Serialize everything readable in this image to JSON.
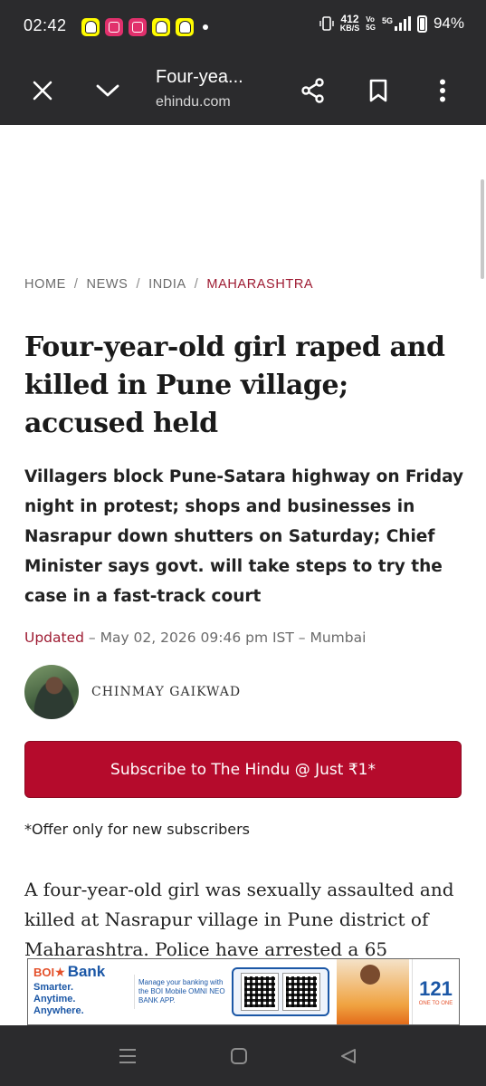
{
  "status_bar": {
    "time": "02:42",
    "net_speed_value": "412",
    "net_speed_unit": "KB/S",
    "volte_label": "Vo\n5G",
    "network_label": "5G",
    "battery": "94%",
    "notification_icons": [
      "snapchat-icon",
      "instagram-icon",
      "instagram-icon",
      "snapchat-icon",
      "snapchat-icon"
    ]
  },
  "toolbar": {
    "title": "Four-yea...",
    "url": "ehindu.com",
    "icons": [
      "close-icon",
      "chevron-down-icon",
      "share-icon",
      "bookmark-icon",
      "more-vert-icon"
    ]
  },
  "article": {
    "breadcrumb": {
      "items": [
        "HOME",
        "NEWS",
        "INDIA"
      ],
      "separator": "/",
      "current": "MAHARASHTRA"
    },
    "headline": "Four-year-old girl raped and killed in Pune village; accused held",
    "subhead": "Villagers block Pune-Satara highway on Friday night in protest; shops and businesses in Nasrapur down shutters on Saturday; Chief Minister says govt. will take steps to try the case in a fast-track court",
    "updated_label": "Updated",
    "updated_text": " – May 02, 2026 09:46 pm IST – Mumbai",
    "author": "CHINMAY GAIKWAD",
    "subscribe_label": "Subscribe to The Hindu @ Just ₹1*",
    "offer_note": "*Offer only for new subscribers",
    "body_text": "A four-year-old girl was sexually assaulted and killed at Nasrapur village in Pune district of Maharashtra. Police have arrested a 65"
  },
  "ad": {
    "brand": "BOI",
    "bank": "Bank",
    "tagline": "Smarter.\nAnytime.\nAnywhere.",
    "message": "Manage your banking with the BOI Mobile OMNI NEO BANK APP.",
    "badge": "121",
    "badge_sub": "ONE TO ONE"
  },
  "colors": {
    "system_bar": "#2b2b2d",
    "accent": "#9e1b32",
    "subscribe_button": "#b50b2c"
  }
}
